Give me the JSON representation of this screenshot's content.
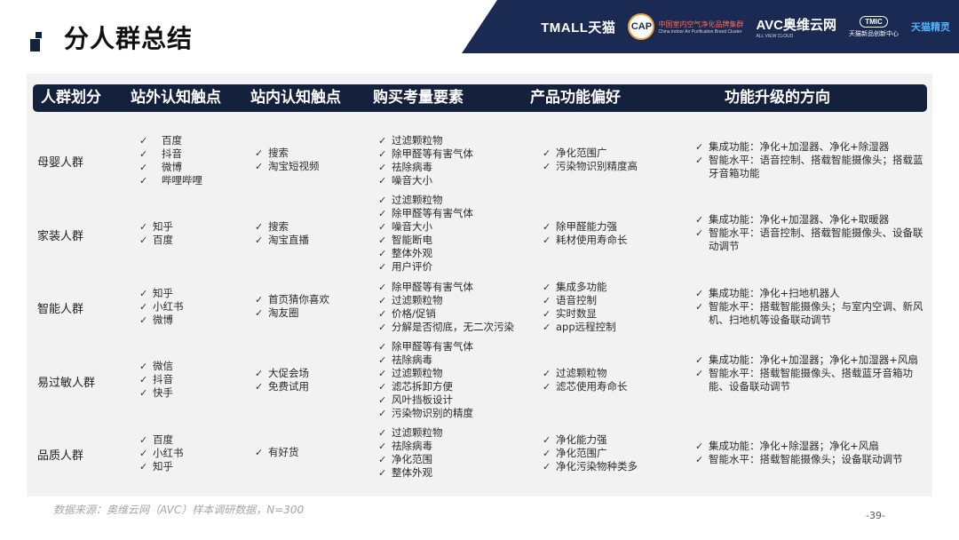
{
  "header": {
    "title": "分人群总结",
    "logos": {
      "tmall": "TMALL天猫",
      "cap_badge": "CAP",
      "cap_cn": "中国室内空气净化品牌集群",
      "cap_en": "China Indoor Air Purification Brand Cluster",
      "avc": "AVC奥维云网",
      "avc_en": "ALL VIEW CLOUD",
      "tmic_badge": "TMIC",
      "tmic_text": "天猫新品创新中心",
      "genie": "天猫精灵"
    }
  },
  "table": {
    "columns": [
      "人群划分",
      "站外认知触点",
      "站内认知触点",
      "购买考量要素",
      "产品功能偏好",
      "功能升级的方向"
    ],
    "rows": [
      {
        "group": "母婴人群",
        "offsite": [
          "百度",
          "抖音",
          "微博",
          "哔哩哔哩"
        ],
        "onsite": [
          "搜索",
          "淘宝短视频"
        ],
        "factors": [
          "过滤颗粒物",
          "除甲醛等有害气体",
          "祛除病毒",
          "噪音大小"
        ],
        "features": [
          "净化范围广",
          "污染物识别精度高"
        ],
        "upgrades": [
          "集成功能：净化+加湿器、净化+除湿器",
          "智能水平：语音控制、搭载智能摄像头；搭载蓝牙音箱功能"
        ]
      },
      {
        "group": "家装人群",
        "offsite": [
          "知乎",
          "百度"
        ],
        "onsite": [
          "搜索",
          "淘宝直播"
        ],
        "factors": [
          "过滤颗粒物",
          "除甲醛等有害气体",
          "噪音大小",
          "智能断电",
          "整体外观",
          "用户评价"
        ],
        "features": [
          "除甲醛能力强",
          "耗材使用寿命长"
        ],
        "upgrades": [
          "集成功能：净化+加湿器、净化+取暖器",
          "智能水平：语音控制、搭载智能摄像头、设备联动调节"
        ]
      },
      {
        "group": "智能人群",
        "offsite": [
          "知乎",
          "小红书",
          "微博"
        ],
        "onsite": [
          "首页猜你喜欢",
          "淘友圈"
        ],
        "factors": [
          "除甲醛等有害气体",
          "过滤颗粒物",
          "价格/促销",
          "分解是否彻底，无二次污染"
        ],
        "features": [
          "集成多功能",
          "语音控制",
          "实时数显",
          "app远程控制"
        ],
        "upgrades": [
          "集成功能：净化+扫地机器人",
          "智能水平：搭载智能摄像头；与室内空调、新风机、扫地机等设备联动调节"
        ]
      },
      {
        "group": "易过敏人群",
        "offsite": [
          "微信",
          "抖音",
          "快手"
        ],
        "onsite": [
          "大促会场",
          "免费试用"
        ],
        "factors": [
          "除甲醛等有害气体",
          "祛除病毒",
          "过滤颗粒物",
          "滤芯拆卸方便",
          "风叶挡板设计",
          "污染物识别的精度"
        ],
        "features": [
          "过滤颗粒物",
          "滤芯使用寿命长"
        ],
        "upgrades": [
          "集成功能：净化+加湿器；净化+加湿器+风扇",
          "智能水平：搭载智能摄像头、搭载蓝牙音箱功能、设备联动调节"
        ]
      },
      {
        "group": "品质人群",
        "offsite": [
          "百度",
          "小红书",
          "知乎"
        ],
        "onsite": [
          "有好货"
        ],
        "factors": [
          "过滤颗粒物",
          "祛除病毒",
          "净化范围",
          "整体外观"
        ],
        "features": [
          "净化能力强",
          "净化范围广",
          "净化污染物种类多"
        ],
        "upgrades": [
          "集成功能：净化+除湿器；净化+风扇",
          "智能水平：搭载智能摄像头；设备联动调节"
        ]
      }
    ]
  },
  "footer": {
    "source": "数据来源：奥维云网（AVC）样本调研数据，N=300",
    "page": "-39-"
  }
}
